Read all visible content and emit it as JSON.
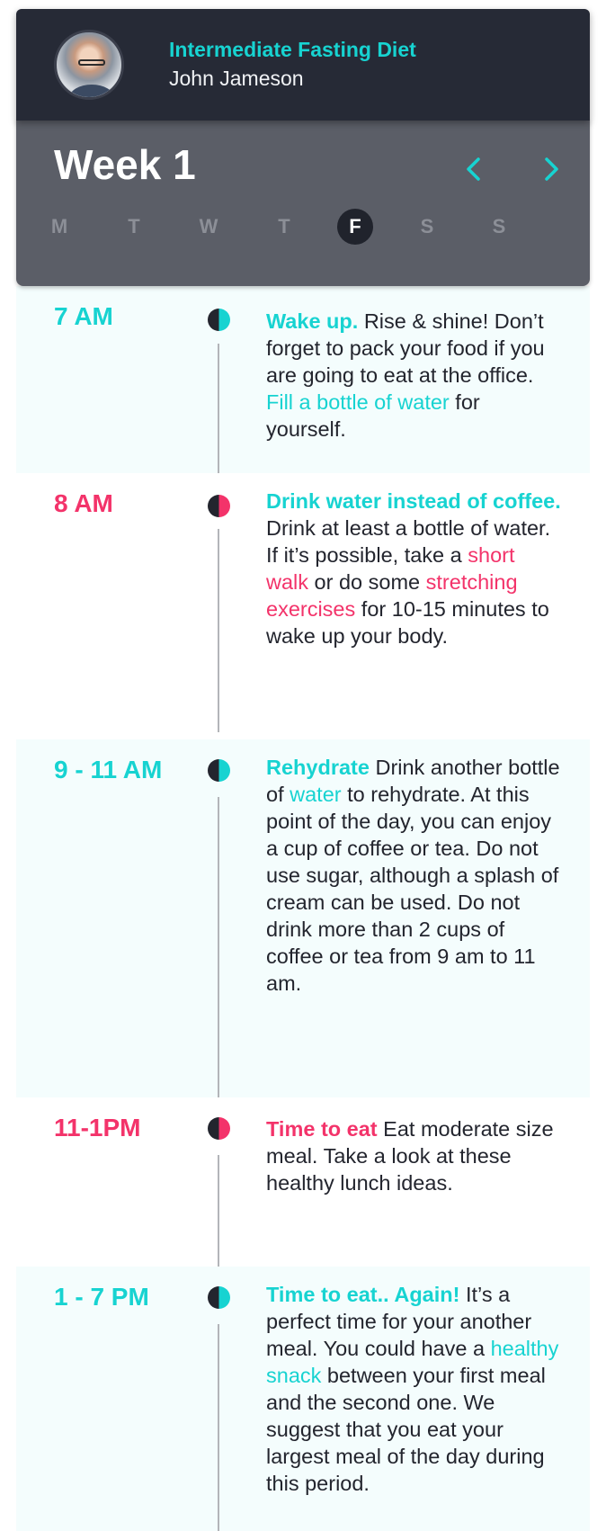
{
  "header": {
    "plan_title": "Intermediate Fasting Diet",
    "user_name": "John Jameson",
    "avatar": "profile-photo"
  },
  "week": {
    "title": "Week 1",
    "prev_icon": "chevron-left-icon",
    "next_icon": "chevron-right-icon",
    "days": [
      "M",
      "T",
      "W",
      "T",
      "F",
      "S",
      "S"
    ],
    "active_day_index": 4
  },
  "colors": {
    "teal": "#17d3d1",
    "pink": "#f3336a",
    "header_bg": "#262a36",
    "weekbar_bg": "#5b5e67",
    "light_section_bg": "#f4fdfd"
  },
  "schedule": [
    {
      "time": "7 AM",
      "accent": "teal",
      "parts": [
        {
          "text": "Wake up.",
          "style": "teal-bold"
        },
        {
          "text": " Rise & shine! Don’t forget to pack your food if you are going to eat at the office. ",
          "style": "plain"
        },
        {
          "text": "Fill a bottle of water",
          "style": "teal"
        },
        {
          "text": " for yourself.",
          "style": "plain"
        }
      ]
    },
    {
      "time": "8 AM",
      "accent": "pink",
      "parts": [
        {
          "text": "Drink water instead of coffee.",
          "style": "teal-bold"
        },
        {
          "text": " Drink at least a bottle of water. If it’s possible, take a ",
          "style": "plain"
        },
        {
          "text": "short walk",
          "style": "pink"
        },
        {
          "text": " or do some ",
          "style": "plain"
        },
        {
          "text": "stretching exercises",
          "style": "pink"
        },
        {
          "text": " for 10-15 minutes to wake up your body.",
          "style": "plain"
        }
      ]
    },
    {
      "time": "9 - 11 AM",
      "accent": "teal",
      "parts": [
        {
          "text": "Rehydrate",
          "style": "teal-bold"
        },
        {
          "text": " Drink another bottle of ",
          "style": "plain"
        },
        {
          "text": "water",
          "style": "teal"
        },
        {
          "text": " to rehydrate. At this point of the day, you can enjoy a cup of coffee or tea. Do not use sugar, although a splash of cream can be used. Do not drink more than 2 cups of coffee or tea from 9 am to 11 am.",
          "style": "plain"
        }
      ]
    },
    {
      "time": "11-1PM",
      "accent": "pink",
      "parts": [
        {
          "text": "Time to eat",
          "style": "pink-bold"
        },
        {
          "text": " Eat moderate size meal. Take a look at these healthy lunch ideas.",
          "style": "plain"
        }
      ]
    },
    {
      "time": "1 - 7 PM",
      "accent": "teal",
      "parts": [
        {
          "text": "Time to eat.. Again!",
          "style": "teal-bold"
        },
        {
          "text": " It’s a perfect time for your another meal. You could have a ",
          "style": "plain"
        },
        {
          "text": "healthy snack",
          "style": "teal"
        },
        {
          "text": " between your first meal and the second one. We suggest that you eat your largest meal of the day during this period.",
          "style": "plain"
        }
      ]
    }
  ]
}
